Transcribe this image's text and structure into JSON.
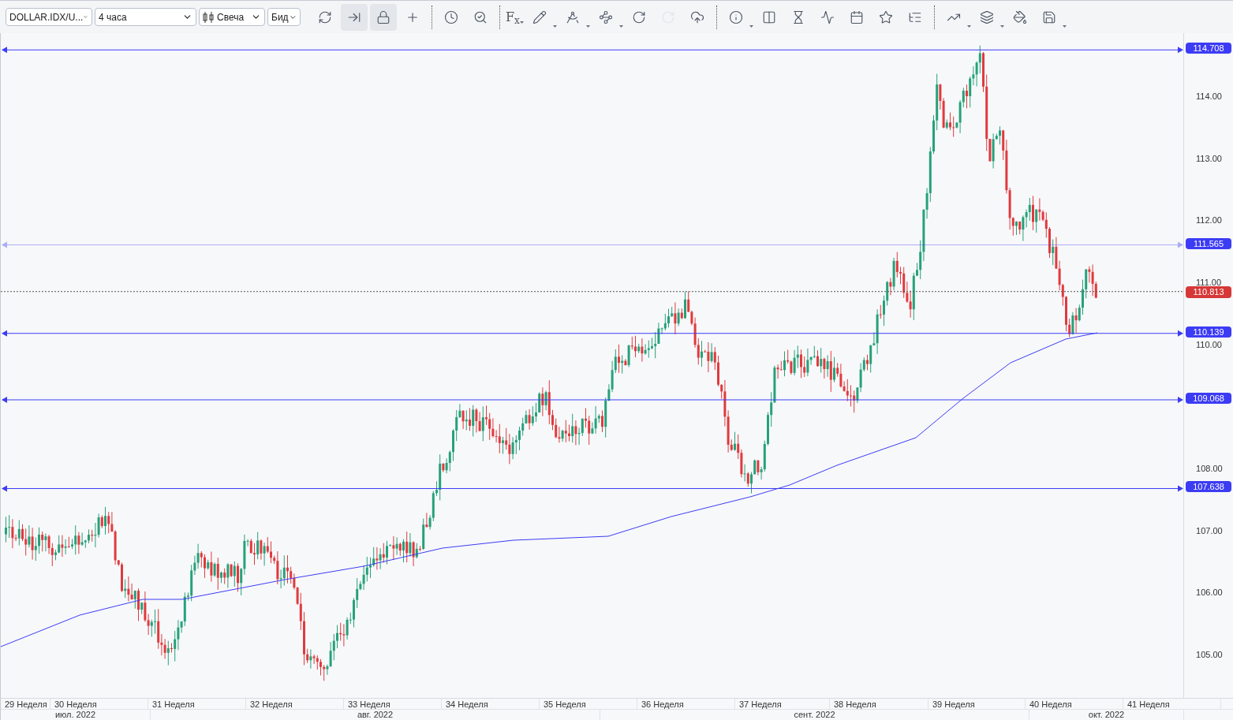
{
  "toolbar": {
    "symbol": "DOLLAR.IDX/U...",
    "timeframe": "4 часа",
    "chart_type": "Свеча",
    "price_type": "Бид",
    "formula_label": "F$_{x}$",
    "tools": [
      {
        "pressed": false,
        "disabled": false
      },
      {
        "pressed": true,
        "disabled": false
      },
      {
        "pressed": true,
        "disabled": false
      },
      {
        "pressed": false,
        "disabled": false
      },
      {
        "pressed": false,
        "disabled": false
      },
      {
        "pressed": false,
        "disabled": false
      },
      {
        "pressed": false,
        "disabled": false
      },
      {
        "pressed": false,
        "disabled": false
      },
      {
        "pressed": false,
        "disabled": false
      },
      {
        "pressed": false,
        "disabled": false
      },
      {
        "pressed": false,
        "disabled": true
      },
      {
        "pressed": false,
        "disabled": false
      },
      {
        "pressed": false,
        "disabled": false
      },
      {
        "pressed": false,
        "disabled": false
      },
      {
        "pressed": false,
        "disabled": false
      },
      {
        "pressed": false,
        "disabled": false
      },
      {
        "pressed": false,
        "disabled": false
      },
      {
        "pressed": false,
        "disabled": false
      },
      {
        "pressed": false,
        "disabled": false
      },
      {
        "pressed": false,
        "disabled": false
      },
      {
        "pressed": false,
        "disabled": false
      },
      {
        "pressed": false,
        "disabled": false
      },
      {
        "pressed": false,
        "disabled": false
      }
    ]
  },
  "price_axis": {
    "labels": [
      "114.00",
      "113.00",
      "112.00",
      "111.00",
      "110.00",
      "108.00",
      "107.00",
      "106.00",
      "105.00"
    ]
  },
  "levels": [
    {
      "price": "114.708",
      "color": "#3c3cf5",
      "dimmed": false
    },
    {
      "price": "111.565",
      "color": "#3c3cf5",
      "dimmed": true
    },
    {
      "price": "110.139",
      "color": "#3c3cf5",
      "dimmed": false
    },
    {
      "price": "109.068",
      "color": "#3c3cf5",
      "dimmed": false
    },
    {
      "price": "107.638",
      "color": "#3c3cf5",
      "dimmed": false
    }
  ],
  "current_price": {
    "price": "110.813",
    "color": "#d63838"
  },
  "time_axis": {
    "weeks": [
      "29 Неделя",
      "30 Неделя",
      "31 Неделя",
      "32 Неделя",
      "33 Неделя",
      "34 Неделя",
      "35 Неделя",
      "36 Неделя",
      "37 Неделя",
      "38 Неделя",
      "39 Неделя",
      "40 Неделя",
      "41 Неделя"
    ],
    "months": [
      "июл. 2022",
      "авг. 2022",
      "сент. 2022",
      "окт. 2022"
    ]
  }
}
